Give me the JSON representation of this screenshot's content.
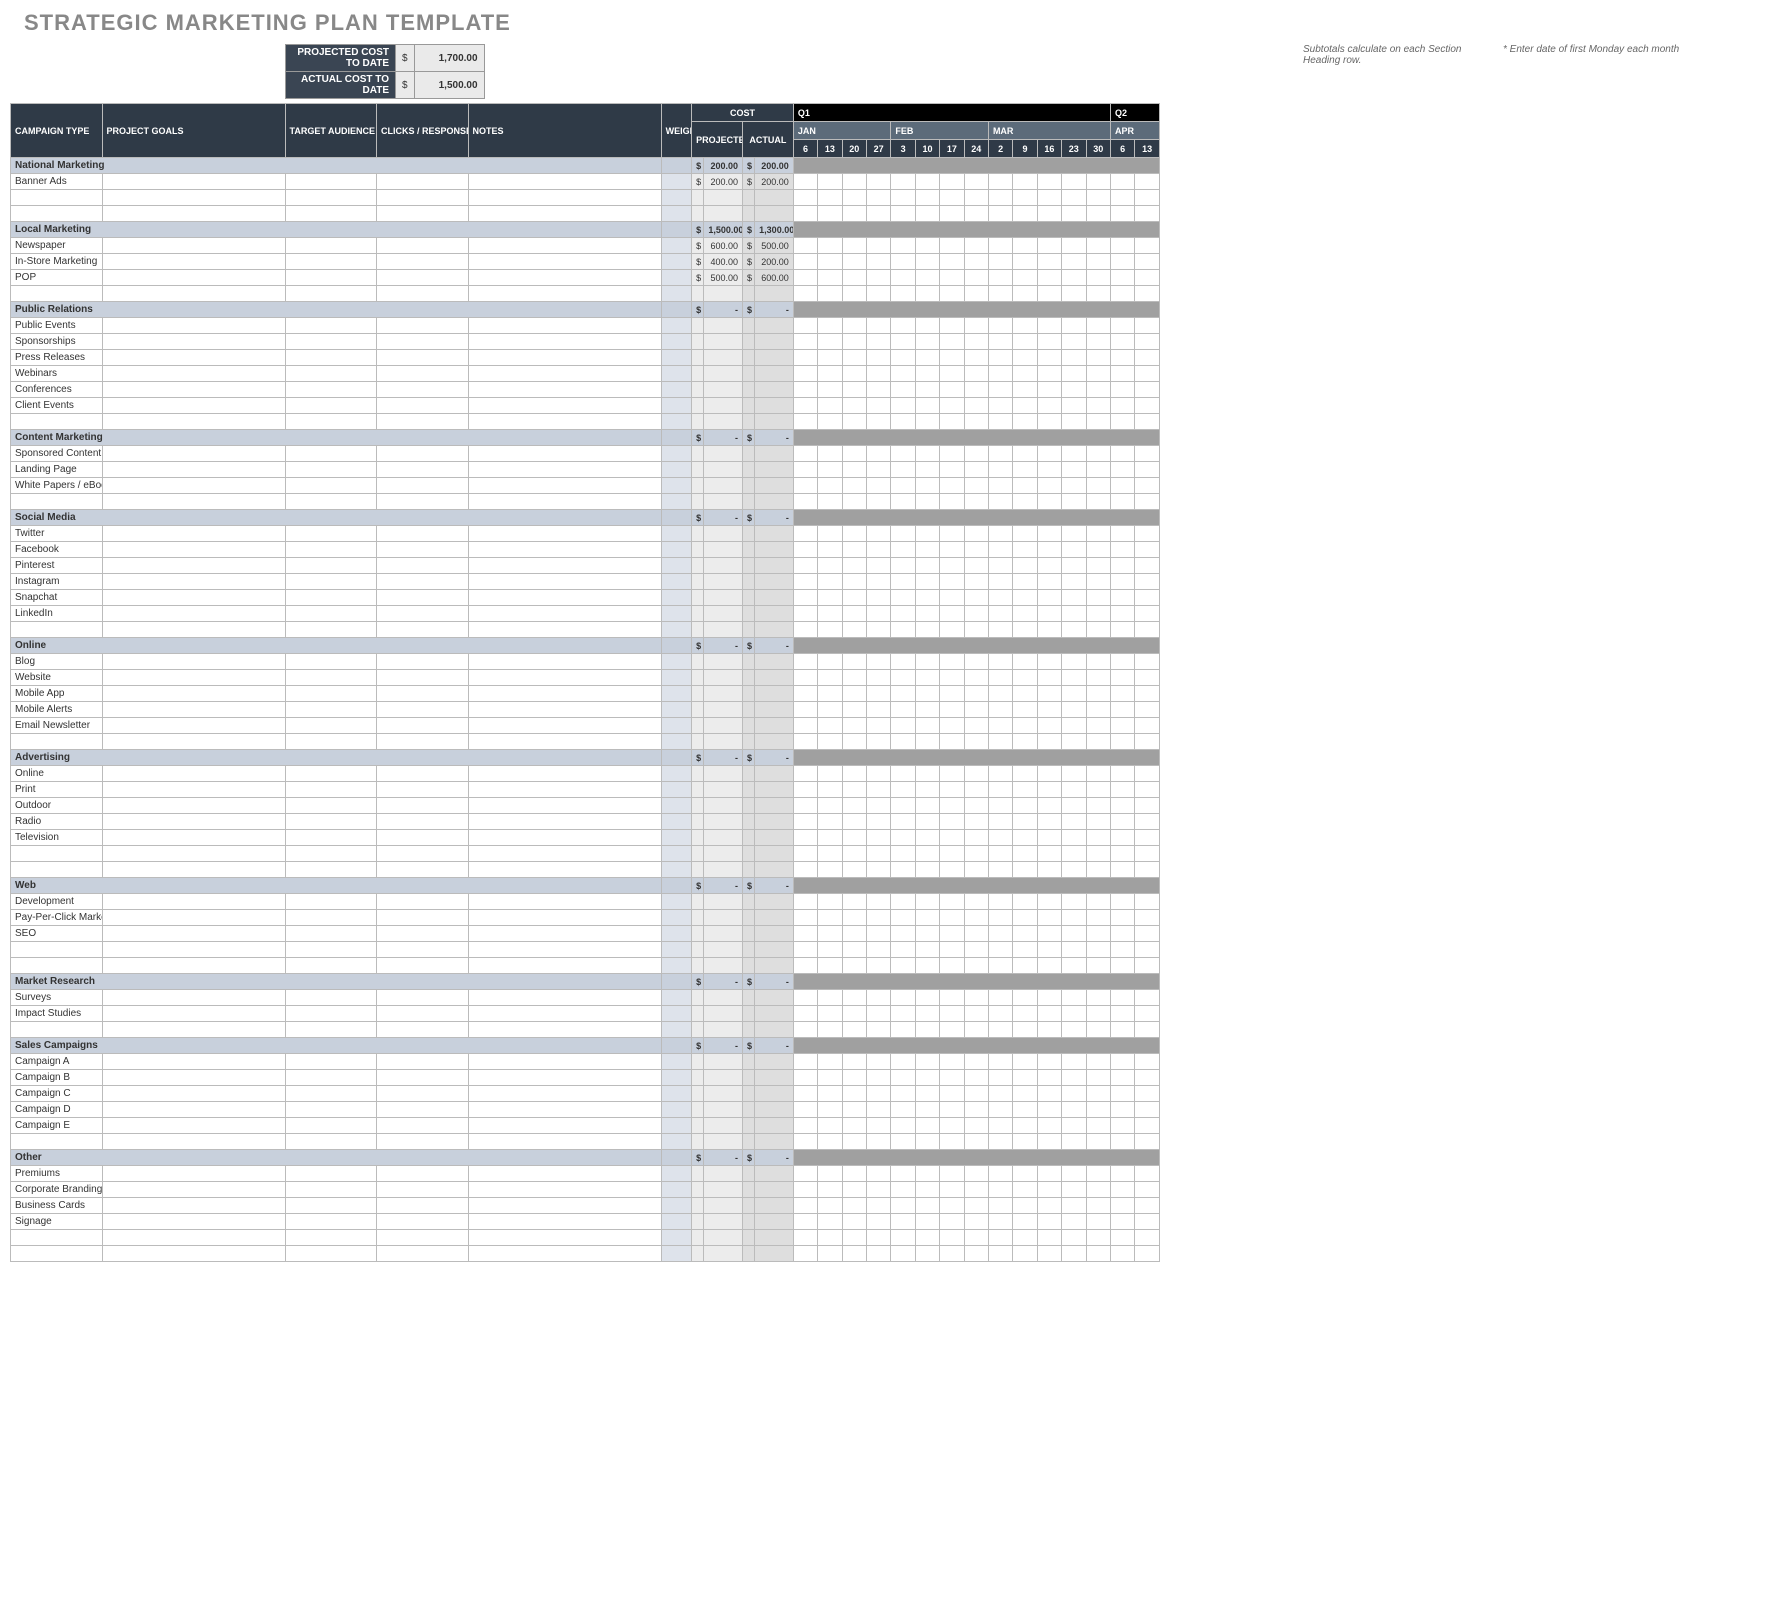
{
  "title": "STRATEGIC MARKETING PLAN TEMPLATE",
  "summary": {
    "projected_label": "PROJECTED COST TO DATE",
    "projected_cur": "$",
    "projected_val": "1,700.00",
    "actual_label": "ACTUAL COST TO DATE",
    "actual_cur": "$",
    "actual_val": "1,500.00"
  },
  "hints": {
    "subtotal": "Subtotals calculate on each Section Heading row.",
    "dates": "* Enter date of first Monday each month"
  },
  "quarters": [
    "Q1",
    "Q2"
  ],
  "months": [
    "JAN",
    "FEB",
    "MAR",
    "APR"
  ],
  "weeks_by_month": [
    [
      "6",
      "13",
      "20",
      "27"
    ],
    [
      "3",
      "10",
      "17",
      "24"
    ],
    [
      "2",
      "9",
      "16",
      "23",
      "30"
    ],
    [
      "6",
      "13"
    ]
  ],
  "headers": {
    "campaign_type": "CAMPAIGN TYPE",
    "project_goals": "PROJECT GOALS",
    "target_audience": "TARGET AUDIENCE",
    "clicks": "CLICKS / RESPONSE",
    "notes": "NOTES",
    "weight": "WEIGHT",
    "cost": "COST",
    "projected": "PROJECTED",
    "actual": "ACTUAL"
  },
  "sections": [
    {
      "name": "National Marketing",
      "proj": "200.00",
      "act": "200.00",
      "items": [
        {
          "name": "Banner Ads",
          "proj": "200.00",
          "act": "200.00"
        },
        {
          "name": ""
        },
        {
          "name": ""
        }
      ]
    },
    {
      "name": "Local Marketing",
      "proj": "1,500.00",
      "act": "1,300.00",
      "items": [
        {
          "name": "Newspaper",
          "proj": "600.00",
          "act": "500.00"
        },
        {
          "name": "In-Store Marketing",
          "proj": "400.00",
          "act": "200.00"
        },
        {
          "name": "POP",
          "proj": "500.00",
          "act": "600.00"
        },
        {
          "name": ""
        }
      ]
    },
    {
      "name": "Public Relations",
      "proj": "-",
      "act": "-",
      "items": [
        {
          "name": "Public Events"
        },
        {
          "name": "Sponsorships"
        },
        {
          "name": "Press Releases"
        },
        {
          "name": "Webinars"
        },
        {
          "name": "Conferences"
        },
        {
          "name": "Client Events"
        },
        {
          "name": ""
        }
      ]
    },
    {
      "name": "Content Marketing",
      "proj": "-",
      "act": "-",
      "items": [
        {
          "name": "Sponsored Content"
        },
        {
          "name": "Landing Page"
        },
        {
          "name": "White Papers / eBooks"
        },
        {
          "name": ""
        }
      ]
    },
    {
      "name": "Social Media",
      "proj": "-",
      "act": "-",
      "items": [
        {
          "name": "Twitter"
        },
        {
          "name": "Facebook"
        },
        {
          "name": "Pinterest"
        },
        {
          "name": "Instagram"
        },
        {
          "name": "Snapchat"
        },
        {
          "name": "LinkedIn"
        },
        {
          "name": ""
        }
      ]
    },
    {
      "name": "Online",
      "proj": "-",
      "act": "-",
      "items": [
        {
          "name": "Blog"
        },
        {
          "name": "Website"
        },
        {
          "name": "Mobile App"
        },
        {
          "name": "Mobile Alerts"
        },
        {
          "name": "Email Newsletter"
        },
        {
          "name": ""
        }
      ]
    },
    {
      "name": "Advertising",
      "proj": "-",
      "act": "-",
      "items": [
        {
          "name": "Online"
        },
        {
          "name": "Print"
        },
        {
          "name": "Outdoor"
        },
        {
          "name": "Radio"
        },
        {
          "name": "Television"
        },
        {
          "name": ""
        },
        {
          "name": ""
        }
      ]
    },
    {
      "name": "Web",
      "proj": "-",
      "act": "-",
      "items": [
        {
          "name": "Development"
        },
        {
          "name": "Pay-Per-Click Marketing"
        },
        {
          "name": "SEO"
        },
        {
          "name": ""
        },
        {
          "name": ""
        }
      ]
    },
    {
      "name": "Market Research",
      "proj": "-",
      "act": "-",
      "items": [
        {
          "name": "Surveys"
        },
        {
          "name": "Impact Studies"
        },
        {
          "name": ""
        }
      ]
    },
    {
      "name": "Sales Campaigns",
      "proj": "-",
      "act": "-",
      "items": [
        {
          "name": "Campaign A"
        },
        {
          "name": "Campaign B"
        },
        {
          "name": "Campaign C"
        },
        {
          "name": "Campaign D"
        },
        {
          "name": "Campaign E"
        },
        {
          "name": ""
        }
      ]
    },
    {
      "name": "Other",
      "proj": "-",
      "act": "-",
      "items": [
        {
          "name": "Premiums"
        },
        {
          "name": "Corporate Branding"
        },
        {
          "name": "Business Cards"
        },
        {
          "name": "Signage"
        },
        {
          "name": ""
        },
        {
          "name": ""
        }
      ]
    }
  ]
}
